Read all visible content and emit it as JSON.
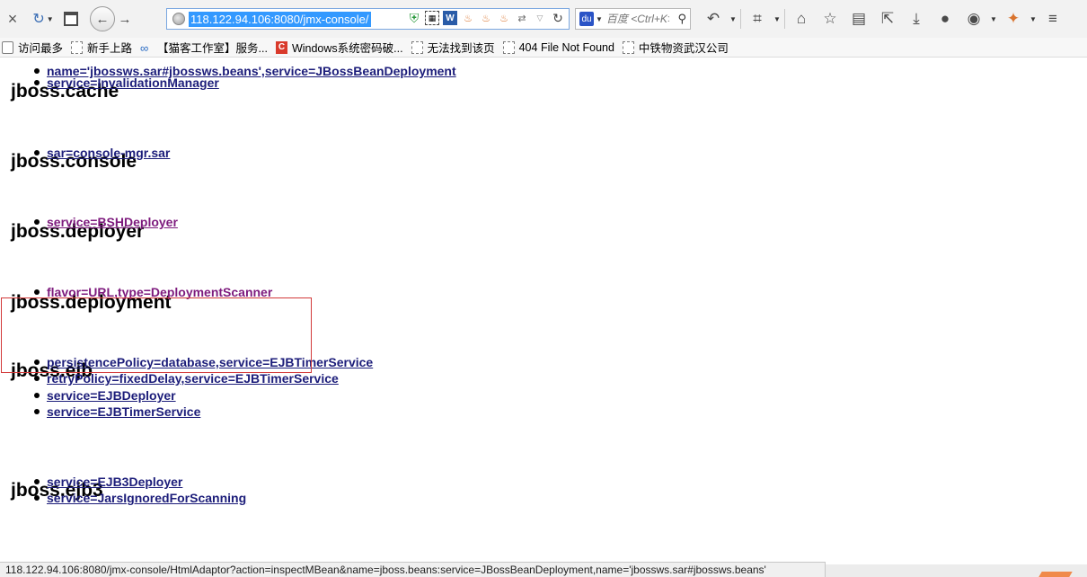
{
  "toolbar": {
    "close_glyph": "×",
    "sync_glyph": "↻",
    "back_glyph": "←",
    "forward_glyph": "→",
    "url": "118.122.94.106:8080/jmx-console/",
    "reload_glyph": "↻",
    "word_glyph": "W",
    "baidu_glyph": "du",
    "search_placeholder": "百度 <Ctrl+K>",
    "search_glyph": "⚲",
    "undo_glyph": "↶",
    "crop_glyph": "⌗",
    "home_glyph": "⌂",
    "star_glyph": "☆",
    "reader_glyph": "▤",
    "share_glyph": "⇱",
    "download_glyph": "⤓",
    "user_glyph": "●",
    "mask_glyph": "◉",
    "ext_glyph": "✦",
    "menu_glyph": "≡"
  },
  "bookmarks": [
    {
      "label": "访问最多",
      "icon": "folder-icon"
    },
    {
      "label": "新手上路",
      "icon": "page-icon"
    },
    {
      "label": "【猫客工作室】服务...",
      "icon": "link-icon"
    },
    {
      "label": "Windows系统密码破...",
      "icon": "red-c-icon"
    },
    {
      "label": "无法找到该页",
      "icon": "page-icon"
    },
    {
      "label": "404 File Not Found",
      "icon": "page-icon"
    },
    {
      "label": "中铁物资武汉公司",
      "icon": "page-icon"
    }
  ],
  "content": {
    "top_item": "name='jbossws.sar#jbossws.beans',service=JBossBeanDeployment",
    "sections": [
      {
        "title": "jboss.cache",
        "items": [
          "service=InvalidationManager"
        ]
      },
      {
        "title": "jboss.console",
        "items": [
          "sar=console-mgr.sar"
        ]
      },
      {
        "title": "jboss.deployer",
        "items": [
          "service=BSHDeployer"
        ]
      },
      {
        "title": "jboss.deployment",
        "items": [
          "flavor=URL,type=DeploymentScanner"
        ]
      },
      {
        "title": "jboss.ejb",
        "items": [
          "persistencePolicy=database,service=EJBTimerService",
          "retryPolicy=fixedDelay,service=EJBTimerService",
          "service=EJBDeployer",
          "service=EJBTimerService"
        ]
      },
      {
        "title": "jboss.ejb3",
        "items": [
          "service=EJB3Deployer",
          "service=JarsIgnoredForScanning"
        ]
      }
    ]
  },
  "status_bar": {
    "text": "118.122.94.106:8080/jmx-console/HtmlAdaptor?action=inspectMBean&name=jboss.beans:service=JBossBeanDeployment,name='jbossws.sar#jbossws.beans'"
  }
}
